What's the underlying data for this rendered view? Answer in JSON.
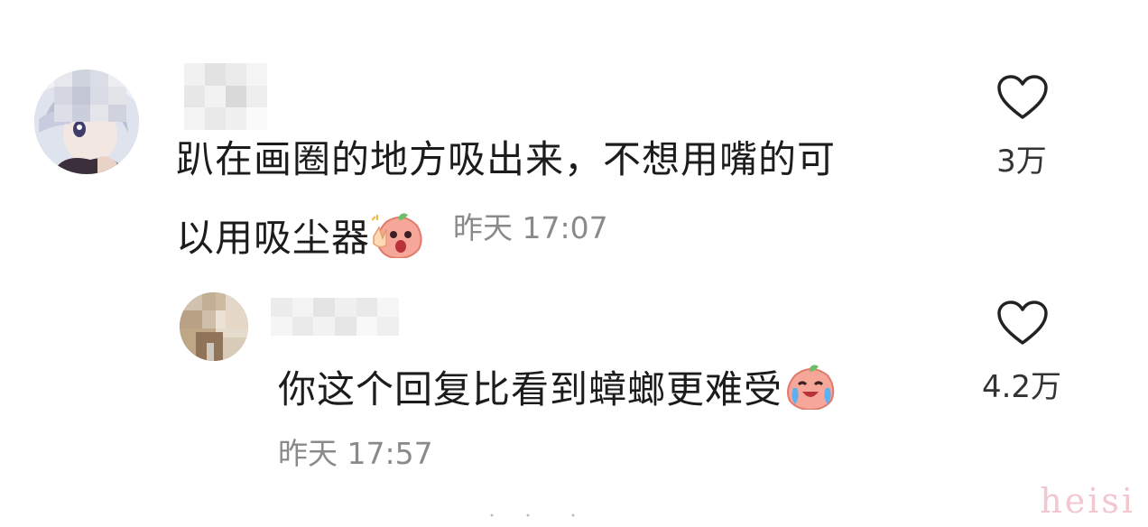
{
  "comments": [
    {
      "avatar": "avatar-anime-character",
      "username_blurred": true,
      "text_line1": "趴在画圈的地方吸出来，不想用嘴的可",
      "text_line2": "以用吸尘器",
      "emoji": "peach-victory-emoji",
      "time": "昨天 17:07",
      "like_icon": "heart-outline-icon",
      "likes": "3万"
    },
    {
      "avatar": "avatar-photo",
      "username_blurred": true,
      "is_reply": true,
      "text_line1": "你这个回复比看到蟑螂更难受",
      "emoji": "peach-crying-emoji",
      "time": "昨天 17:57",
      "like_icon": "heart-outline-icon",
      "likes": "4.2万"
    }
  ],
  "watermark": "heisi",
  "colors": {
    "text": "#1c1c1c",
    "meta": "#8a8a8a",
    "watermark": "#f2c7cf",
    "emoji_peach": "#f6a79a"
  }
}
